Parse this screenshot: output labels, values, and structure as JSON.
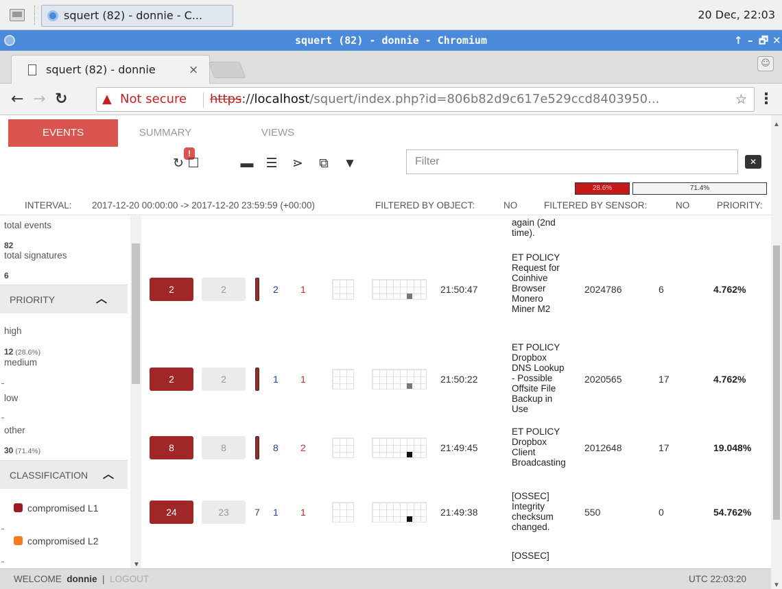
{
  "taskbar": {
    "task_label": "squert (82) - donnie - C...",
    "clock": "20 Dec, 22:03"
  },
  "window": {
    "title": "squert (82) - donnie - Chromium",
    "controls": [
      "↑",
      "–",
      "🗗",
      "✕"
    ]
  },
  "browser": {
    "tab_title": "squert (82) - donnie",
    "tab_close": "×",
    "security_text": "Not secure",
    "url_scheme": "https",
    "url_sep": "://",
    "url_host": "localhost",
    "url_path": "/squert/index.php?id=806b82d9c617e529ccd8403950..."
  },
  "app": {
    "tabs": [
      "EVENTS",
      "SUMMARY",
      "VIEWS"
    ],
    "active_tab": "EVENTS",
    "refresh_badge": "!",
    "filter_placeholder": "Filter",
    "progress": [
      {
        "label": "28.6%",
        "value": 28.6,
        "color": "#c41a1a"
      },
      {
        "label": "71.4%",
        "value": 71.4,
        "color": "#f4f4f4"
      }
    ],
    "status": {
      "interval_label": "INTERVAL:",
      "interval_value": "2017-12-20 00:00:00 -> 2017-12-20 23:59:59 (+00:00)",
      "filtered_object_label": "FILTERED BY OBJECT:",
      "filtered_object_value": "NO",
      "filtered_sensor_label": "FILTERED BY SENSOR:",
      "filtered_sensor_value": "NO",
      "priority_label": "PRIORITY:"
    }
  },
  "sidebar": {
    "total_events_label": "total events",
    "total_events": "82",
    "total_signatures_label": "total signatures",
    "total_signatures": "6",
    "priority_header": "PRIORITY",
    "priorities": [
      {
        "label": "high",
        "count": "12",
        "pct": "(28.6%)"
      },
      {
        "label": "medium",
        "count": "",
        "pct": ""
      },
      {
        "label": "low",
        "count": "",
        "pct": ""
      },
      {
        "label": "other",
        "count": "30",
        "pct": "(71.4%)"
      }
    ],
    "classification_header": "CLASSIFICATION",
    "classifications": [
      {
        "label": "compromised L1",
        "color": "#9b1c22"
      },
      {
        "label": "compromised L2",
        "color": "#f47b20"
      }
    ]
  },
  "events": {
    "partial_top_text": [
      "again (2nd",
      "time)."
    ],
    "rows": [
      {
        "count": "2",
        "count2": "2",
        "sev_num": "",
        "src": "2",
        "dst": "1",
        "time": "21:50:47",
        "signature": [
          "ET POLICY",
          "Request for",
          "Coinhive",
          "Browser",
          "Monero",
          "Miner M2"
        ],
        "sigid": "2024786",
        "rev": "6",
        "pct": "4.762%",
        "mark_color": "#777"
      },
      {
        "count": "2",
        "count2": "2",
        "sev_num": "",
        "src": "1",
        "dst": "1",
        "time": "21:50:22",
        "signature": [
          "ET POLICY",
          "Dropbox",
          "DNS Lookup",
          "- Possible",
          "Offsite File",
          "Backup in",
          "Use"
        ],
        "sigid": "2020565",
        "rev": "17",
        "pct": "4.762%",
        "mark_color": "#777"
      },
      {
        "count": "8",
        "count2": "8",
        "sev_num": "",
        "src": "8",
        "dst": "2",
        "time": "21:49:45",
        "signature": [
          "ET POLICY",
          "Dropbox",
          "Client",
          "Broadcasting"
        ],
        "sigid": "2012648",
        "rev": "17",
        "pct": "19.048%",
        "mark_color": "#111"
      },
      {
        "count": "24",
        "count2": "23",
        "sev_num": "7",
        "src": "1",
        "dst": "1",
        "time": "21:49:38",
        "signature": [
          "[OSSEC]",
          "Integrity",
          "checksum",
          "changed."
        ],
        "sigid": "550",
        "rev": "0",
        "pct": "54.762%",
        "mark_color": "#111"
      }
    ],
    "partial_bottom_text": "[OSSEC]"
  },
  "footer": {
    "welcome": "WELCOME",
    "user": "donnie",
    "separator": "|",
    "logout": "LOGOUT",
    "utc": "UTC 22:03:20"
  }
}
